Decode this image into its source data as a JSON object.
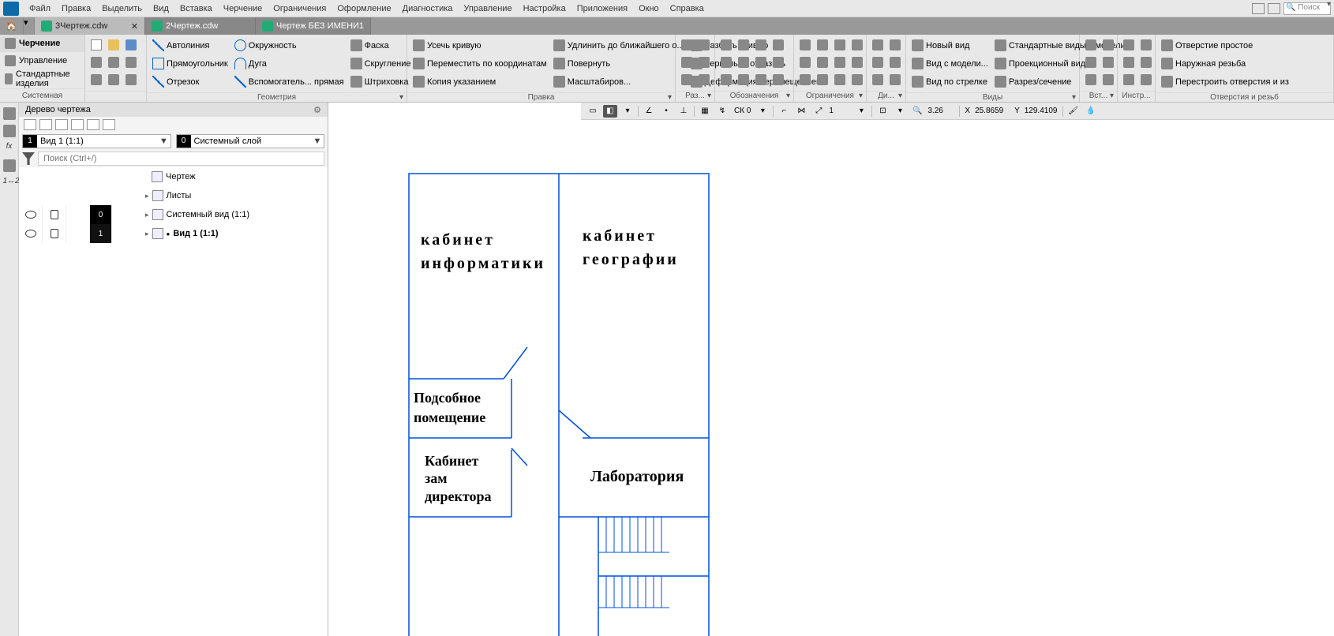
{
  "menus": [
    "Файл",
    "Правка",
    "Выделить",
    "Вид",
    "Вставка",
    "Черчение",
    "Ограничения",
    "Оформление",
    "Диагностика",
    "Управление",
    "Настройка",
    "Приложения",
    "Окно",
    "Справка"
  ],
  "search_placeholder": "Поиск",
  "tabs": [
    {
      "label": "3Чертеж.cdw",
      "active": true,
      "close": "✕"
    },
    {
      "label": "2Чертеж.cdw",
      "active": false
    },
    {
      "label": "Чертеж БЕЗ ИМЕНИ1",
      "active": false
    }
  ],
  "ribbon_left": {
    "items": [
      "Черчение",
      "Управление",
      "Стандартные изделия"
    ],
    "footer": "Системная"
  },
  "ribbon": {
    "geometry": {
      "label": "Геометрия",
      "items": [
        "Автолиния",
        "Прямоугольник",
        "Отрезок",
        "Окружность",
        "Дуга",
        "Вспомогатель... прямая",
        "Фаска",
        "Скругление",
        "Штриховка"
      ]
    },
    "edit": {
      "label": "Правка",
      "items": [
        "Усечь кривую",
        "Переместить по координатам",
        "Копия указанием",
        "Удлинить до ближайшего о...",
        "Повернуть",
        "Масштабиров...",
        "Разбить кривую",
        "Зеркально отразить",
        "Деформация перемещением"
      ]
    },
    "razm": {
      "label": "Раз..."
    },
    "oboz": {
      "label": "Обозначения"
    },
    "ogr": {
      "label": "Ограничения"
    },
    "diag": {
      "label": "Ди..."
    },
    "views": {
      "label": "Виды",
      "items": [
        "Новый вид",
        "Вид с модели...",
        "Вид по стрелке",
        "Стандартные виды с модели...",
        "Проекционный вид",
        "Разрез/сечение"
      ]
    },
    "vst": {
      "label": "Вст..."
    },
    "instr": {
      "label": "Инстр..."
    },
    "holes": {
      "label": "Отверстия и резьб",
      "items": [
        "Отверстие простое",
        "Наружная резьба",
        "Перестроить отверстия и из"
      ]
    }
  },
  "tree": {
    "title": "Дерево чертежа",
    "combo1": {
      "num": "1",
      "text": "Вид 1 (1:1)"
    },
    "combo2": {
      "num": "0",
      "text": "Системный слой"
    },
    "search_placeholder": "Поиск (Ctrl+/)",
    "rows": [
      {
        "label": "Чертеж",
        "indent": 0,
        "cells": false
      },
      {
        "label": "Листы",
        "indent": 1,
        "cells": false,
        "arrow": true
      },
      {
        "label": "Системный вид (1:1)",
        "indent": 1,
        "cells": true,
        "num": "0",
        "arrow": true
      },
      {
        "label": "Вид 1 (1:1)",
        "indent": 1,
        "cells": true,
        "num": "1",
        "arrow": true,
        "dot": true,
        "active": true
      }
    ]
  },
  "status": {
    "ck": "СК 0",
    "step": "1",
    "zoom": "3.26",
    "x_label": "X",
    "x": "25.8659",
    "y_label": "Y",
    "y": "129.4109"
  },
  "plan": {
    "r1a": "кабинет",
    "r1b": "информатики",
    "r2a": "кабинет",
    "r2b": "географии",
    "r3a": "Подсобное",
    "r3b": "помещение",
    "r4a": "Кабинет",
    "r4b": "зам",
    "r4c": "директора",
    "r5": "Лаборатория"
  }
}
